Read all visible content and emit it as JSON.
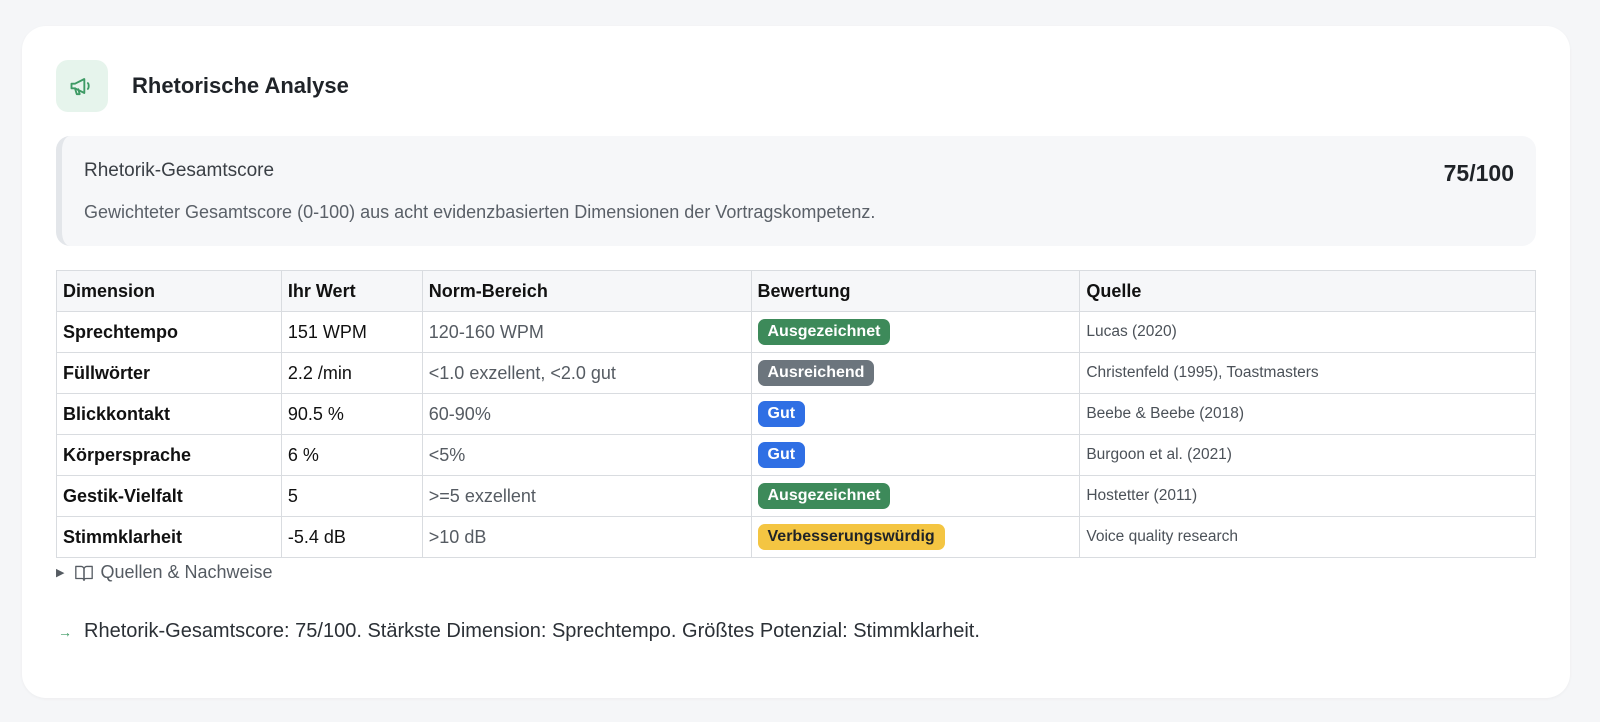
{
  "header": {
    "title": "Rhetorische Analyse",
    "icon": "megaphone-icon",
    "icon_color": "#3d9a64"
  },
  "score": {
    "label": "Rhetorik-Gesamtscore",
    "value": "75/100",
    "description": "Gewichteter Gesamtscore (0-100) aus acht evidenzbasierten Dimensionen der Vortragskompetenz."
  },
  "table": {
    "headers": [
      "Dimension",
      "Ihr Wert",
      "Norm-Bereich",
      "Bewertung",
      "Quelle"
    ],
    "rows": [
      {
        "dimension": "Sprechtempo",
        "value": "151 WPM",
        "norm": "120-160 WPM",
        "rating": "Ausgezeichnet",
        "rating_color": "#3d8a5a",
        "rating_text_color": "#ffffff",
        "source": "Lucas (2020)"
      },
      {
        "dimension": "Füllwörter",
        "value": "2.2 /min",
        "norm": "<1.0 exzellent, <2.0 gut",
        "rating": "Ausreichend",
        "rating_color": "#6c757d",
        "rating_text_color": "#ffffff",
        "source": "Christenfeld (1995), Toastmasters"
      },
      {
        "dimension": "Blickkontakt",
        "value": "90.5 %",
        "norm": "60-90%",
        "rating": "Gut",
        "rating_color": "#2f6fe4",
        "rating_text_color": "#ffffff",
        "source": "Beebe & Beebe (2018)"
      },
      {
        "dimension": "Körpersprache",
        "value": "6 %",
        "norm": "<5%",
        "rating": "Gut",
        "rating_color": "#2f6fe4",
        "rating_text_color": "#ffffff",
        "source": "Burgoon et al. (2021)"
      },
      {
        "dimension": "Gestik-Vielfalt",
        "value": "5",
        "norm": ">=5 exzellent",
        "rating": "Ausgezeichnet",
        "rating_color": "#3d8a5a",
        "rating_text_color": "#ffffff",
        "source": "Hostetter (2011)"
      },
      {
        "dimension": "Stimmklarheit",
        "value": "-5.4 dB",
        "norm": ">10 dB",
        "rating": "Verbesserungswürdig",
        "rating_color": "#f4c542",
        "rating_text_color": "#1f2328",
        "source": "Voice quality research"
      }
    ]
  },
  "sources": {
    "label": "Quellen & Nachweise",
    "icon": "book-icon",
    "toggle_icon": "triangle-right-icon"
  },
  "summary": {
    "icon": "arrow-right-icon",
    "text": "Rhetorik-Gesamtscore: 75/100. Stärkste Dimension: Sprechtempo. Größtes Potenzial: Stimmklarheit."
  }
}
